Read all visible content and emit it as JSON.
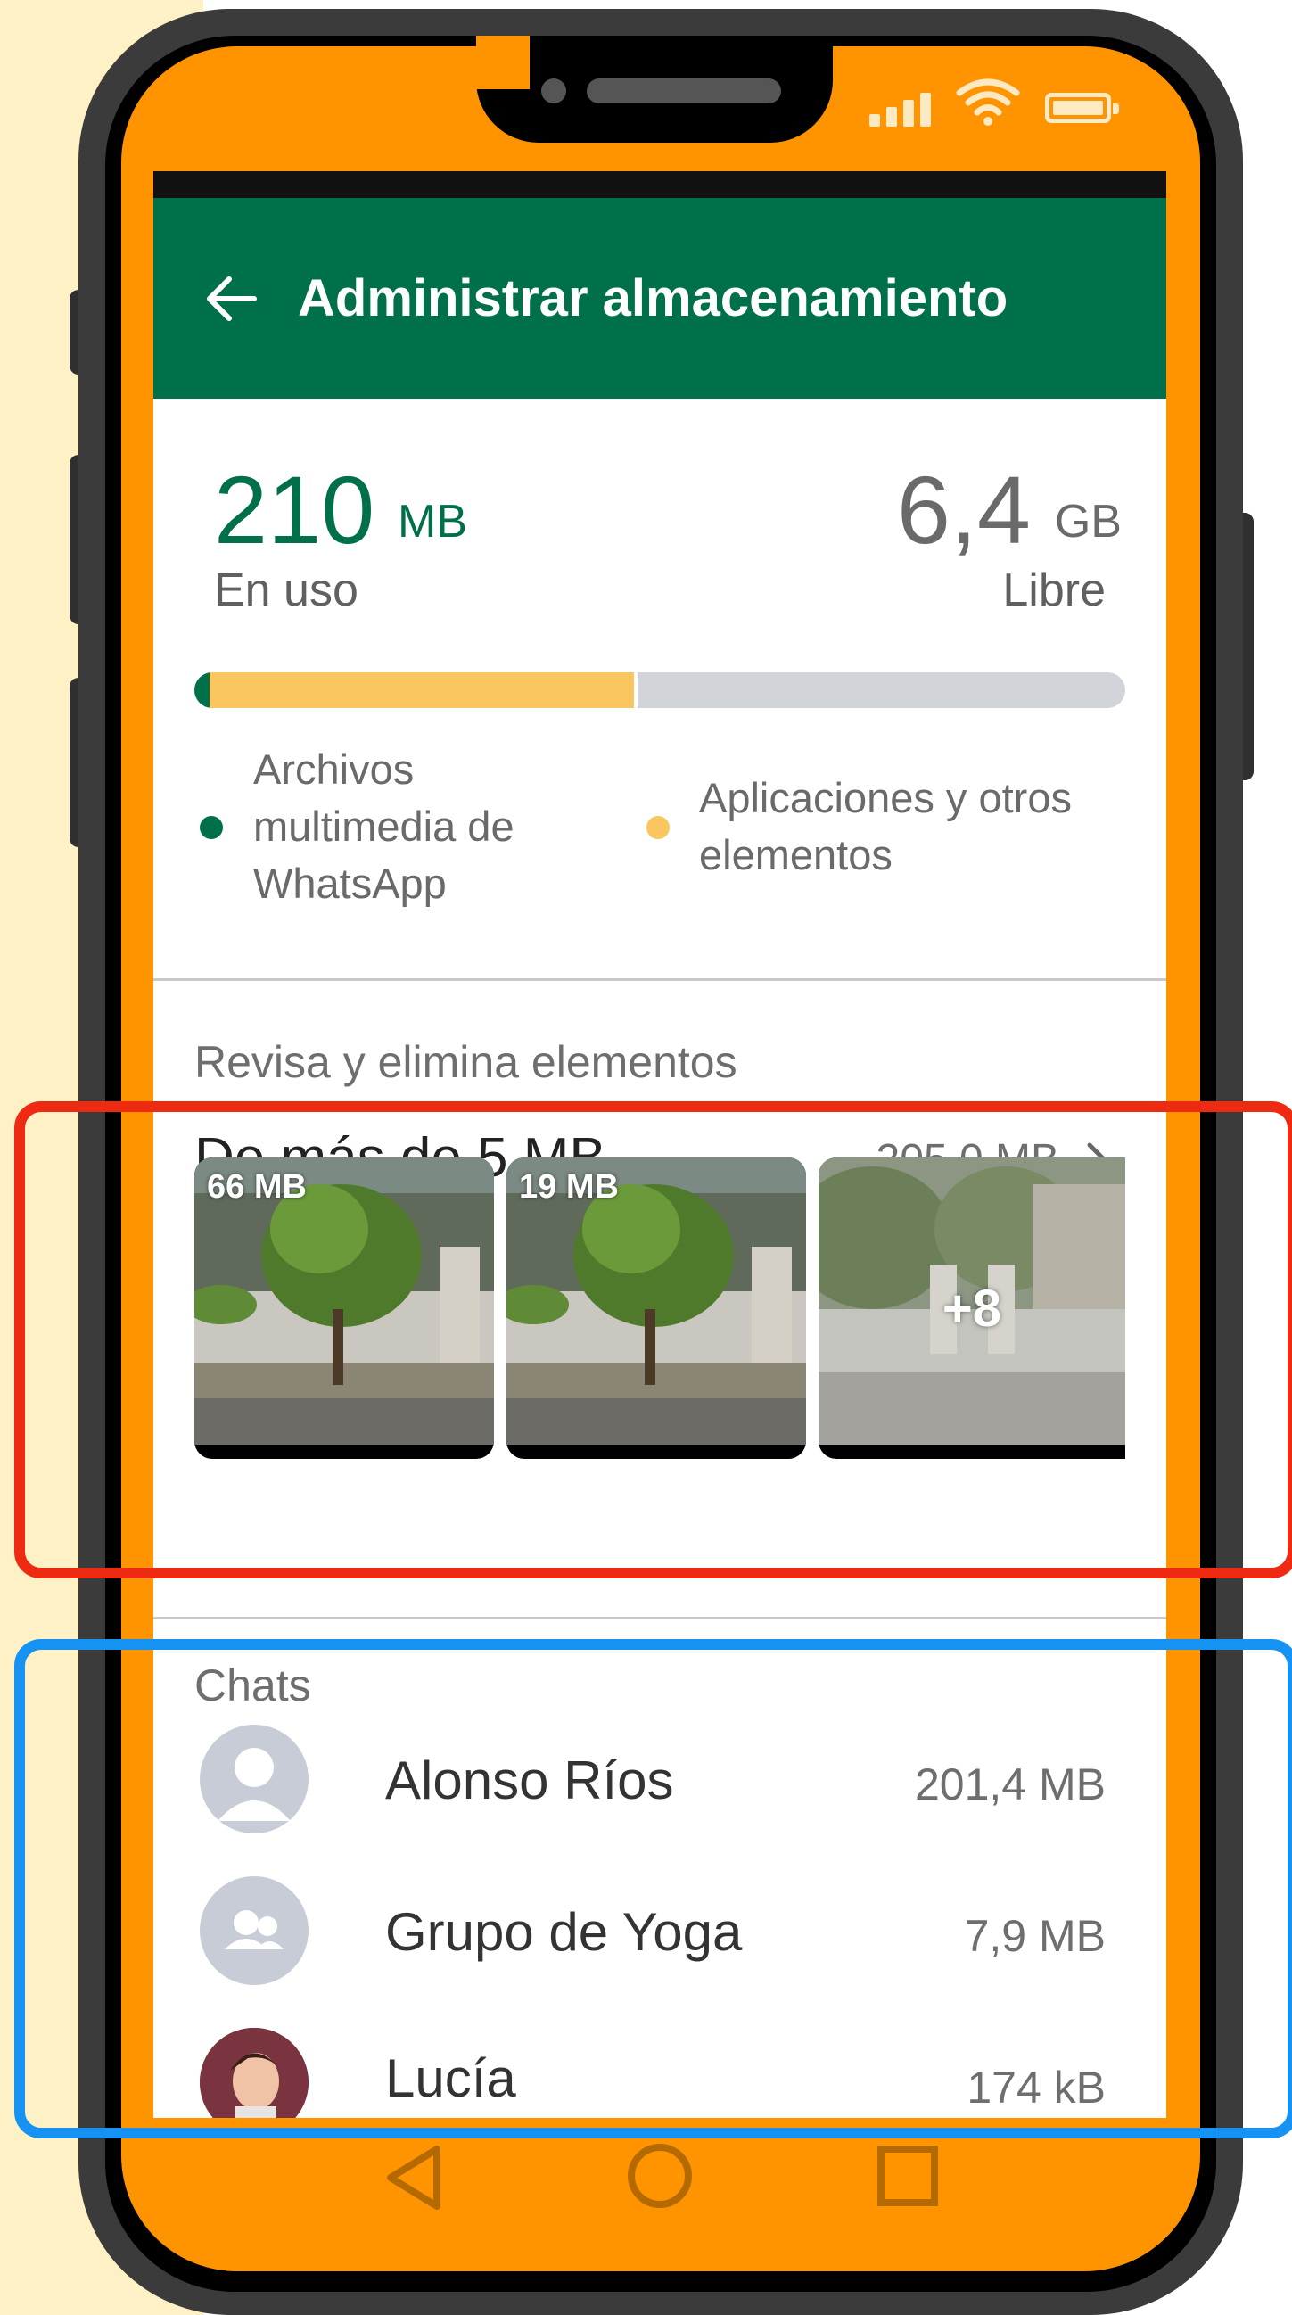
{
  "colors": {
    "brand_green": "#00704a",
    "phone_orange": "#ff9400",
    "media_yellow": "#fbc65f",
    "free_gray": "#d1d5d9",
    "highlight_red": "#ee2a12",
    "highlight_blue": "#1693f2"
  },
  "status_bar": {
    "icons": [
      "signal-icon",
      "wifi-icon",
      "battery-icon"
    ]
  },
  "appbar": {
    "back_icon": "arrow-left-icon",
    "title": "Administrar almacenamiento"
  },
  "storage": {
    "used_value": "210",
    "used_unit": "MB",
    "used_label": "En uso",
    "free_value": "6,4",
    "free_unit": "GB",
    "free_label": "Libre",
    "bar": {
      "whatsapp_fraction": 0.016,
      "apps_fraction": 0.46
    },
    "legend": {
      "whatsapp_line1": "Archivos",
      "whatsapp_line2": "multimedia de",
      "whatsapp_line3": "WhatsApp",
      "apps_line1": "Aplicaciones y otros",
      "apps_line2": "elementos"
    }
  },
  "review": {
    "section_label": "Revisa y elimina elementos",
    "title": "De más de 5 MB",
    "size": "205,0 MB",
    "thumbnails": [
      {
        "label": "66 MB"
      },
      {
        "label": "19 MB"
      },
      {
        "overlay": "+8"
      }
    ]
  },
  "chats": {
    "section_label": "Chats",
    "items": [
      {
        "name": "Alonso Ríos",
        "size": "201,4 MB",
        "avatar": "person-icon"
      },
      {
        "name": "Grupo de Yoga",
        "size": "7,9 MB",
        "avatar": "group-icon"
      },
      {
        "name": "Lucía",
        "size": "174 kB",
        "avatar": "photo-avatar"
      }
    ]
  },
  "navbar": {
    "icons": [
      "back-triangle-icon",
      "home-circle-icon",
      "recents-square-icon"
    ]
  }
}
